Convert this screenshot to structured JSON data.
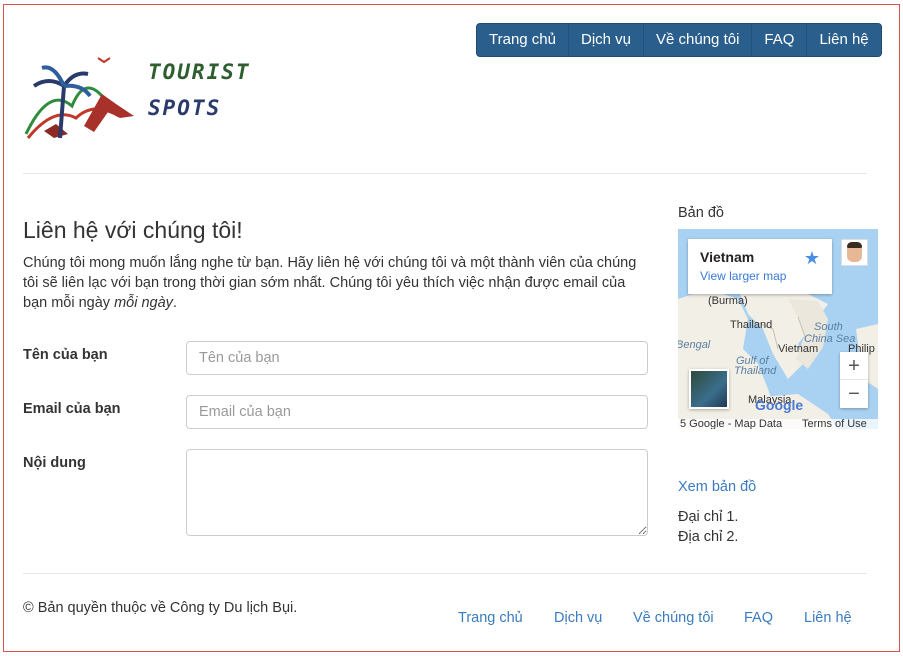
{
  "header": {
    "logo": {
      "line1": "TOURIST",
      "line2": "SPOTS"
    },
    "nav": [
      "Trang chủ",
      "Dịch vụ",
      "Về chúng tôi",
      "FAQ",
      "Liên hệ"
    ]
  },
  "main": {
    "title": "Liên hệ với chúng tôi!",
    "intro_text": "Chúng tôi mong muốn lắng nghe từ bạn. Hãy liên hệ với chúng tôi và một thành viên của chúng tôi sẽ liên lạc với bạn trong thời gian sớm nhất. Chúng tôi yêu thích việc nhận được email của bạn mỗi ngày ",
    "intro_emphasis": "mỗi ngày",
    "intro_end": ".",
    "form": {
      "name_label": "Tên của bạn",
      "name_placeholder": "Tên của bạn",
      "email_label": "Email của bạn",
      "email_placeholder": "Email của bạn",
      "message_label": "Nội dung",
      "message_value": ""
    }
  },
  "sidebar": {
    "map_title": "Bản đồ",
    "map": {
      "place": "Vietnam",
      "larger_map_link": "View larger map",
      "labels": {
        "burma": "(Burma)",
        "thailand": "Thailand",
        "south_china_sea_1": "South",
        "south_china_sea_2": "China Sea",
        "vietnam": "Vietnam",
        "philippines": "Philip",
        "bengal": "Bengal",
        "gulf1": "Gulf of",
        "gulf2": "Thailand",
        "malaysia": "Malaysia"
      },
      "brand": "Google",
      "map_data": "5 Google - Map Data",
      "terms": "Terms of Use",
      "zoom_in": "+",
      "zoom_out": "−"
    },
    "see_map_link": "Xem bản đồ",
    "address1": "Đại chỉ 1.",
    "address2": "Địa chỉ 2."
  },
  "footer": {
    "copyright": "© Bản quyền thuộc về Công ty Du lịch Bụi.",
    "nav": [
      "Trang chủ",
      "Dịch vụ",
      "Về chúng tôi",
      "FAQ",
      "Liên hệ"
    ]
  }
}
